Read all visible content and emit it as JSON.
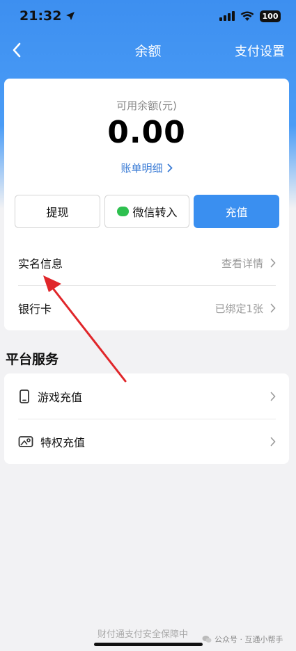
{
  "status_bar": {
    "time": "21:32",
    "battery": "100"
  },
  "nav": {
    "title": "余额",
    "right_action": "支付设置"
  },
  "balance": {
    "label": "可用余额(元)",
    "amount": "0.00",
    "bill_link": "账单明细"
  },
  "buttons": {
    "withdraw": "提现",
    "wechat_transfer": "微信转入",
    "recharge": "充值"
  },
  "rows": {
    "real_name": {
      "label": "实名信息",
      "value": "查看详情"
    },
    "bank_card": {
      "label": "银行卡",
      "value": "已绑定1张"
    }
  },
  "services": {
    "title": "平台服务",
    "items": [
      {
        "label": "游戏充值",
        "icon": "phone-icon"
      },
      {
        "label": "特权充值",
        "icon": "privilege-icon"
      }
    ]
  },
  "footer": {
    "security_text": "财付通支付安全保障中",
    "watermark": "公众号 · 互通小帮手"
  },
  "colors": {
    "accent": "#3a8ff0",
    "link": "#3a7bd5",
    "annotation_arrow": "#e0262a"
  }
}
